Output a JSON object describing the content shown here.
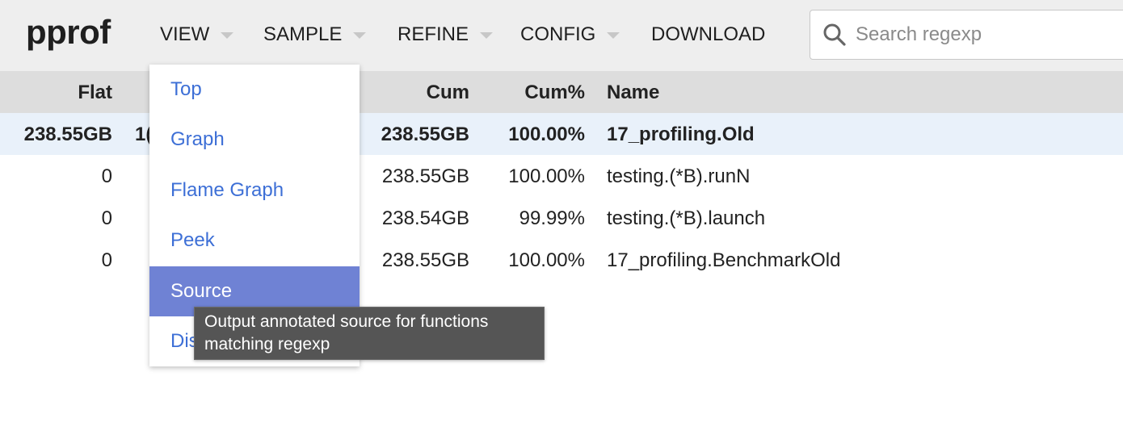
{
  "app": {
    "logo": "pprof"
  },
  "menubar": {
    "view": "VIEW",
    "sample": "SAMPLE",
    "refine": "REFINE",
    "config": "CONFIG",
    "download": "DOWNLOAD"
  },
  "search": {
    "placeholder": "Search regexp",
    "value": ""
  },
  "table": {
    "headers": {
      "flat": "Flat",
      "cum": "Cum",
      "cum_pct": "Cum%",
      "name": "Name"
    },
    "rows": [
      {
        "flat": "238.55GB",
        "flat_pct": "1(",
        "cum": "238.55GB",
        "cum_pct": "100.00%",
        "name": "17_profiling.Old",
        "selected": true
      },
      {
        "flat": "0",
        "cum": "238.55GB",
        "cum_pct": "100.00%",
        "name": "testing.(*B).runN"
      },
      {
        "flat": "0",
        "cum": "238.54GB",
        "cum_pct": "99.99%",
        "name": "testing.(*B).launch"
      },
      {
        "flat": "0",
        "cum": "238.55GB",
        "cum_pct": "100.00%",
        "name": "17_profiling.BenchmarkOld"
      }
    ]
  },
  "view_menu": {
    "items": [
      {
        "label": "Top"
      },
      {
        "label": "Graph"
      },
      {
        "label": "Flame Graph"
      },
      {
        "label": "Peek"
      },
      {
        "label": "Source",
        "active": true
      },
      {
        "label": "Dis"
      }
    ]
  },
  "tooltip": {
    "text_line1": "Output annotated source for functions",
    "text_line2": "matching regexp"
  },
  "colors": {
    "header_bg": "#eeeeee",
    "table_header_bg": "#dddddd",
    "selected_row_bg": "#e9f1fa",
    "menu_link": "#3d6fd6",
    "menu_active_bg": "#6f82d4",
    "tooltip_bg": "#555555"
  },
  "icons": {
    "search": "search-icon",
    "caret": "caret-down-icon"
  }
}
